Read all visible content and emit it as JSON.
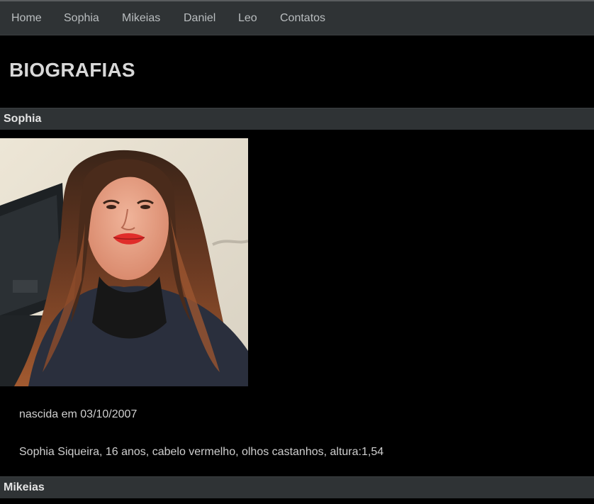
{
  "nav": {
    "items": [
      {
        "label": "Home"
      },
      {
        "label": "Sophia"
      },
      {
        "label": "Mikeias"
      },
      {
        "label": "Daniel"
      },
      {
        "label": "Leo"
      },
      {
        "label": "Contatos"
      }
    ]
  },
  "page": {
    "title": "BIOGRAFIAS"
  },
  "sections": [
    {
      "name": "Sophia",
      "photo": "portrait-photo",
      "paragraphs": [
        "nascida em 03/10/2007",
        "Sophia Siqueira, 16 anos, cabelo vermelho, olhos castanhos, altura:1,54"
      ]
    },
    {
      "name": "Mikeias"
    }
  ],
  "colors": {
    "background": "#000000",
    "navbar": "#2f3335",
    "nav_text": "#b9bdbf",
    "heading_text": "#d8d8d8",
    "body_text": "#cfcfcf"
  }
}
